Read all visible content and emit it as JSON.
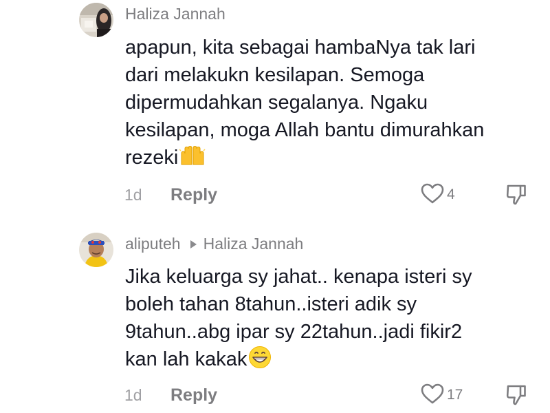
{
  "comments": [
    {
      "author": "Haliza Jannah",
      "lines": [
        "apapun, kita sebagai hambaNya tak lari",
        "dari melakukn kesilapan. Semoga",
        "dipermudahkan segalanya. Ngaku",
        "kesilapan, moga Allah bantu dimurahkan",
        "rezeki"
      ],
      "emoji": "raised-hands-emoji",
      "timestamp": "1d",
      "reply_label": "Reply",
      "like_count": "4"
    },
    {
      "author": "aliputeh",
      "reply_to": "Haliza Jannah",
      "lines": [
        "Jika keluarga sy jahat.. kenapa isteri sy",
        "boleh tahan 8tahun..isteri adik sy",
        "9tahun..abg ipar sy 22tahun..jadi fikir2",
        "kan lah kakak"
      ],
      "emoji": "grinning-face-emoji",
      "timestamp": "1d",
      "reply_label": "Reply",
      "like_count": "17"
    }
  ],
  "icons": {
    "like": "heart-outline-icon",
    "dislike": "thumbs-down-outline-icon"
  },
  "colors": {
    "text_primary": "#161823",
    "text_secondary": "#7d7d80",
    "text_muted": "#a0a0a3",
    "background": "#ffffff"
  }
}
